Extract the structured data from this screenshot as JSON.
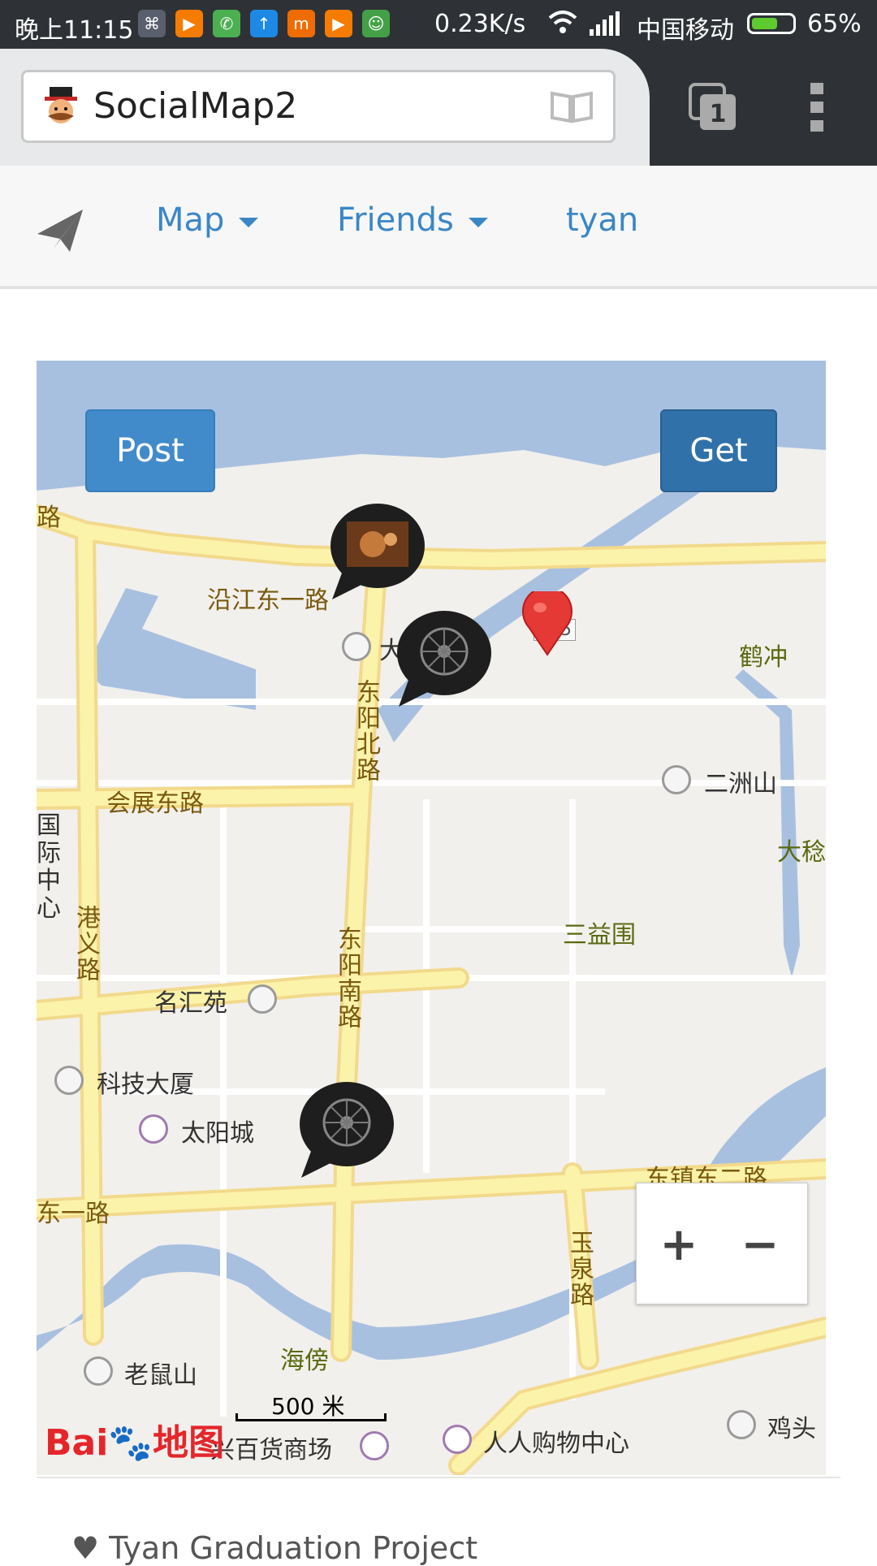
{
  "status_bar": {
    "time": "晚上11:15",
    "speed": "0.23K/s",
    "carrier": "中国移动",
    "battery_percent": "65%",
    "battery_level": 0.65
  },
  "browser": {
    "tab_title": "SocialMap2",
    "tab_count": "1"
  },
  "navbar": {
    "map_label": "Map",
    "friends_label": "Friends",
    "user_label": "tyan"
  },
  "map": {
    "post_label": "Post",
    "get_label": "Get",
    "road_labels": {
      "yanjiang": "沿江东一路",
      "huizhan": "会展东路",
      "dongyang_north": "东阳北路",
      "dongyang_south": "东阳南路",
      "gangyi": "港义路",
      "yuquan": "玉泉路",
      "dongyi": "东一路",
      "dongzhen": "东镇东二路",
      "lu_fragment": "路",
      "route_badge": "575"
    },
    "place_labels": {
      "erzhoushan": "二洲山",
      "sanyiwei": "三益围",
      "hechong": "鹤冲",
      "dawen": "大稔",
      "guoji": "国际中心",
      "minghuiyuan": "名汇苑",
      "kejidasha": "科技大厦",
      "taiyangcheng": "太阳城",
      "laoshushan": "老鼠山",
      "haibang": "海傍",
      "baihuo": "兴百货商场",
      "renren": "人人购物中心",
      "jitou": "鸡头",
      "da_fragment": "大"
    },
    "scale_label": "500 米",
    "logo_text_1": "Bai",
    "logo_text_2": "地图",
    "zoom_in": "+",
    "zoom_out": "−"
  },
  "footer": {
    "text": "♥ Tyan Graduation Project"
  },
  "colors": {
    "accent": "#3a87c7",
    "post_button": "#428bca",
    "get_button": "#3071a9",
    "road": "#fbf3a9",
    "water": "#a8c0e0"
  }
}
